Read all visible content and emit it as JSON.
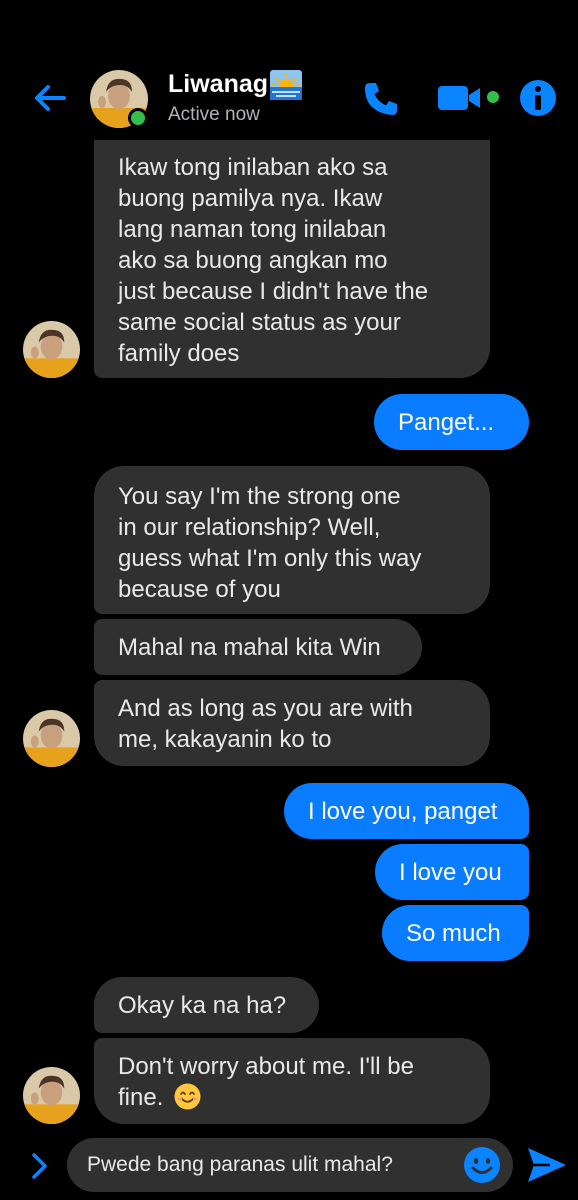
{
  "header": {
    "contact_name": "Liwanag",
    "status": "Active now",
    "name_emoji_icon": "sunrise-over-sea-icon",
    "icons": [
      "back-arrow-icon",
      "phone-icon",
      "video-camera-icon",
      "info-icon"
    ]
  },
  "colors": {
    "background": "#000000",
    "incoming_bubble": "#303030",
    "outgoing_bubble": "#0a7cff",
    "accent": "#0a84ff",
    "active_dot": "#31c14b",
    "secondary_text": "#b0b3b8"
  },
  "messages": {
    "m1": {
      "direction": "incoming",
      "lines": [
        "Ikaw tong inilaban ako sa",
        "buong pamilya nya. Ikaw",
        "lang naman tong inilaban",
        "ako sa buong angkan mo",
        "just because I didn't have the",
        "same social status as your",
        "family does"
      ]
    },
    "m2": {
      "direction": "outgoing",
      "text": "Panget..."
    },
    "m3": {
      "direction": "incoming",
      "lines": [
        "You say I'm the strong one",
        "in our relationship? Well,",
        "guess what I'm only this way",
        "because of you"
      ]
    },
    "m4": {
      "direction": "incoming",
      "text": "Mahal na mahal kita Win"
    },
    "m5": {
      "direction": "incoming",
      "lines": [
        "And as long as you are with",
        "me, kakayanin ko to"
      ]
    },
    "m6": {
      "direction": "outgoing",
      "text": "I love you, panget"
    },
    "m7": {
      "direction": "outgoing",
      "text": "I love you"
    },
    "m8": {
      "direction": "outgoing",
      "text": "So much"
    },
    "m9": {
      "direction": "incoming",
      "text": "Okay ka na ha?"
    },
    "m10": {
      "direction": "incoming",
      "lines": [
        "Don't worry about me. I'll be",
        "fine."
      ],
      "trailing_emoji_icon": "smiling-face-icon"
    }
  },
  "composer": {
    "input_value": "Pwede bang paranas ulit mahal?",
    "icons": [
      "chevron-right-icon",
      "emoji-smile-icon",
      "send-icon"
    ]
  }
}
